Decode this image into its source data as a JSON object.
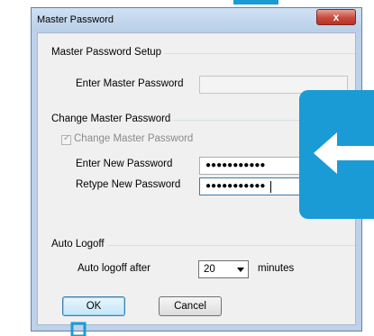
{
  "window": {
    "title": "Master Password",
    "close_glyph": "x"
  },
  "setup_group": {
    "title": "Master Password Setup",
    "enter_label": "Enter Master Password",
    "enter_value": ""
  },
  "change_group": {
    "title": "Change Master Password",
    "checkbox_label": "Change Master Password",
    "checkbox_checked": true,
    "new_label": "Enter New Password",
    "new_value": "●●●●●●●●●●●",
    "retype_label": "Retype New Password",
    "retype_value": "●●●●●●●●●●●"
  },
  "logoff_group": {
    "title": "Auto Logoff",
    "after_label": "Auto logoff after",
    "selected_value": "20",
    "unit_label": "minutes"
  },
  "buttons": {
    "ok": "OK",
    "cancel": "Cancel"
  },
  "colors": {
    "overlay_accent": "#1a9bd6",
    "close_red": "#c74a3a"
  },
  "overlay": {
    "arrow_icon": "arrow-left-icon"
  }
}
